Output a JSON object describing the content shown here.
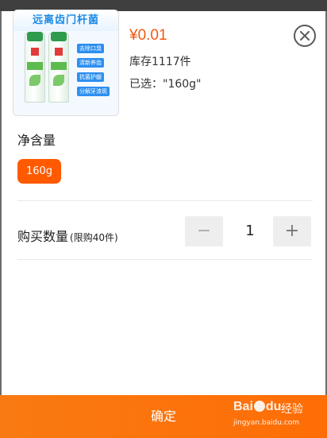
{
  "product": {
    "image_banner": "远离齿门杆菌",
    "tags": [
      "去除口臭",
      "清新养齿",
      "抗菌护龈",
      "分解牙渣斑"
    ],
    "price": "¥0.01",
    "stock": "库存1117件",
    "selected": "已选：\"160g\""
  },
  "spec": {
    "label": "净含量",
    "options": [
      {
        "label": "160g",
        "selected": true
      }
    ]
  },
  "quantity": {
    "label": "购买数量",
    "limit": "(限购40件)",
    "value": "1",
    "minus": "−",
    "plus": "+"
  },
  "footer": {
    "confirm_label": "确定",
    "watermark_brand": "Bai du",
    "watermark_jingyan": "经验",
    "watermark_site": "jingyan.baidu.com"
  },
  "colors": {
    "accent": "#ff5a00",
    "price": "#f05a14",
    "footer": "#f97a12"
  },
  "icons": {
    "close": "close-circle-icon"
  }
}
